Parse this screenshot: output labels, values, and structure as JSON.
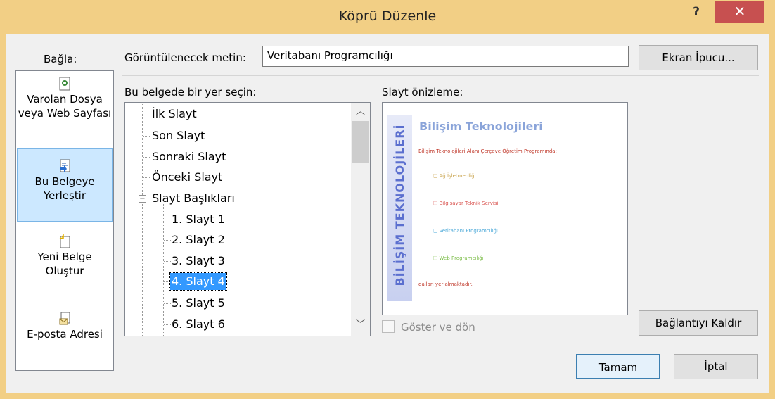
{
  "window": {
    "title": "Köprü Düzenle",
    "help": "?",
    "close": "✕"
  },
  "labels": {
    "link_to": "Bağla:",
    "display_text_label": "Görüntülenecek metin:",
    "place_label": "Bu belgede bir yer seçin:",
    "preview_label": "Slayt önizleme:"
  },
  "display_text_value": "Veritabanı Programcılığı",
  "buttons": {
    "screen_tip": "Ekran İpucu...",
    "remove_link": "Bağlantıyı Kaldır",
    "ok": "Tamam",
    "cancel": "İptal"
  },
  "link_panel": {
    "items": [
      {
        "label": "Varolan Dosya veya Web Sayfası",
        "icon": "existing-file-icon",
        "selected": false
      },
      {
        "label": "Bu Belgeye Yerleştir",
        "icon": "place-in-document-icon",
        "selected": true
      },
      {
        "label": "Yeni Belge Oluştur",
        "icon": "new-document-icon",
        "selected": false
      },
      {
        "label": "E-posta Adresi",
        "icon": "email-icon",
        "selected": false
      }
    ]
  },
  "tree": {
    "top_items": [
      "İlk Slayt",
      "Son Slayt",
      "Sonraki Slayt",
      "Önceki Slayt"
    ],
    "group": "Slayt Başlıkları",
    "group_expander": "−",
    "children": [
      "1. Slayt 1",
      "2. Slayt 2",
      "3. Slayt 3",
      "4. Slayt 4",
      "5. Slayt 5",
      "6. Slayt 6"
    ],
    "selected": "4. Slayt 4"
  },
  "preview": {
    "side_text": "BİLİŞİM TEKNOLOJİLERİ",
    "title": "Bilişim Teknolojileri",
    "line1": "Bilişim Teknolojileri Alanı Çerçeve Öğretim Programında;",
    "bullets": [
      {
        "text": "❑ Ağ İşletmenliği",
        "color": "#c8a24a"
      },
      {
        "text": "❑ Bilgisayar Teknik Servisi",
        "color": "#d9534f"
      },
      {
        "text": "❑ Veritabanı Programcılığı",
        "color": "#4aa8d8"
      },
      {
        "text": "❑ Web Programcılığı",
        "color": "#7fbf4d"
      }
    ],
    "footer": "dalları yer almaktadır."
  },
  "show_and_return": {
    "label": "Göster ve dön",
    "checked": false,
    "enabled": false
  },
  "colors": {
    "title_bar": "#f2cf85",
    "close_button": "#c75050",
    "selection": "#3399ff",
    "link_selected": "#cce8ff"
  }
}
